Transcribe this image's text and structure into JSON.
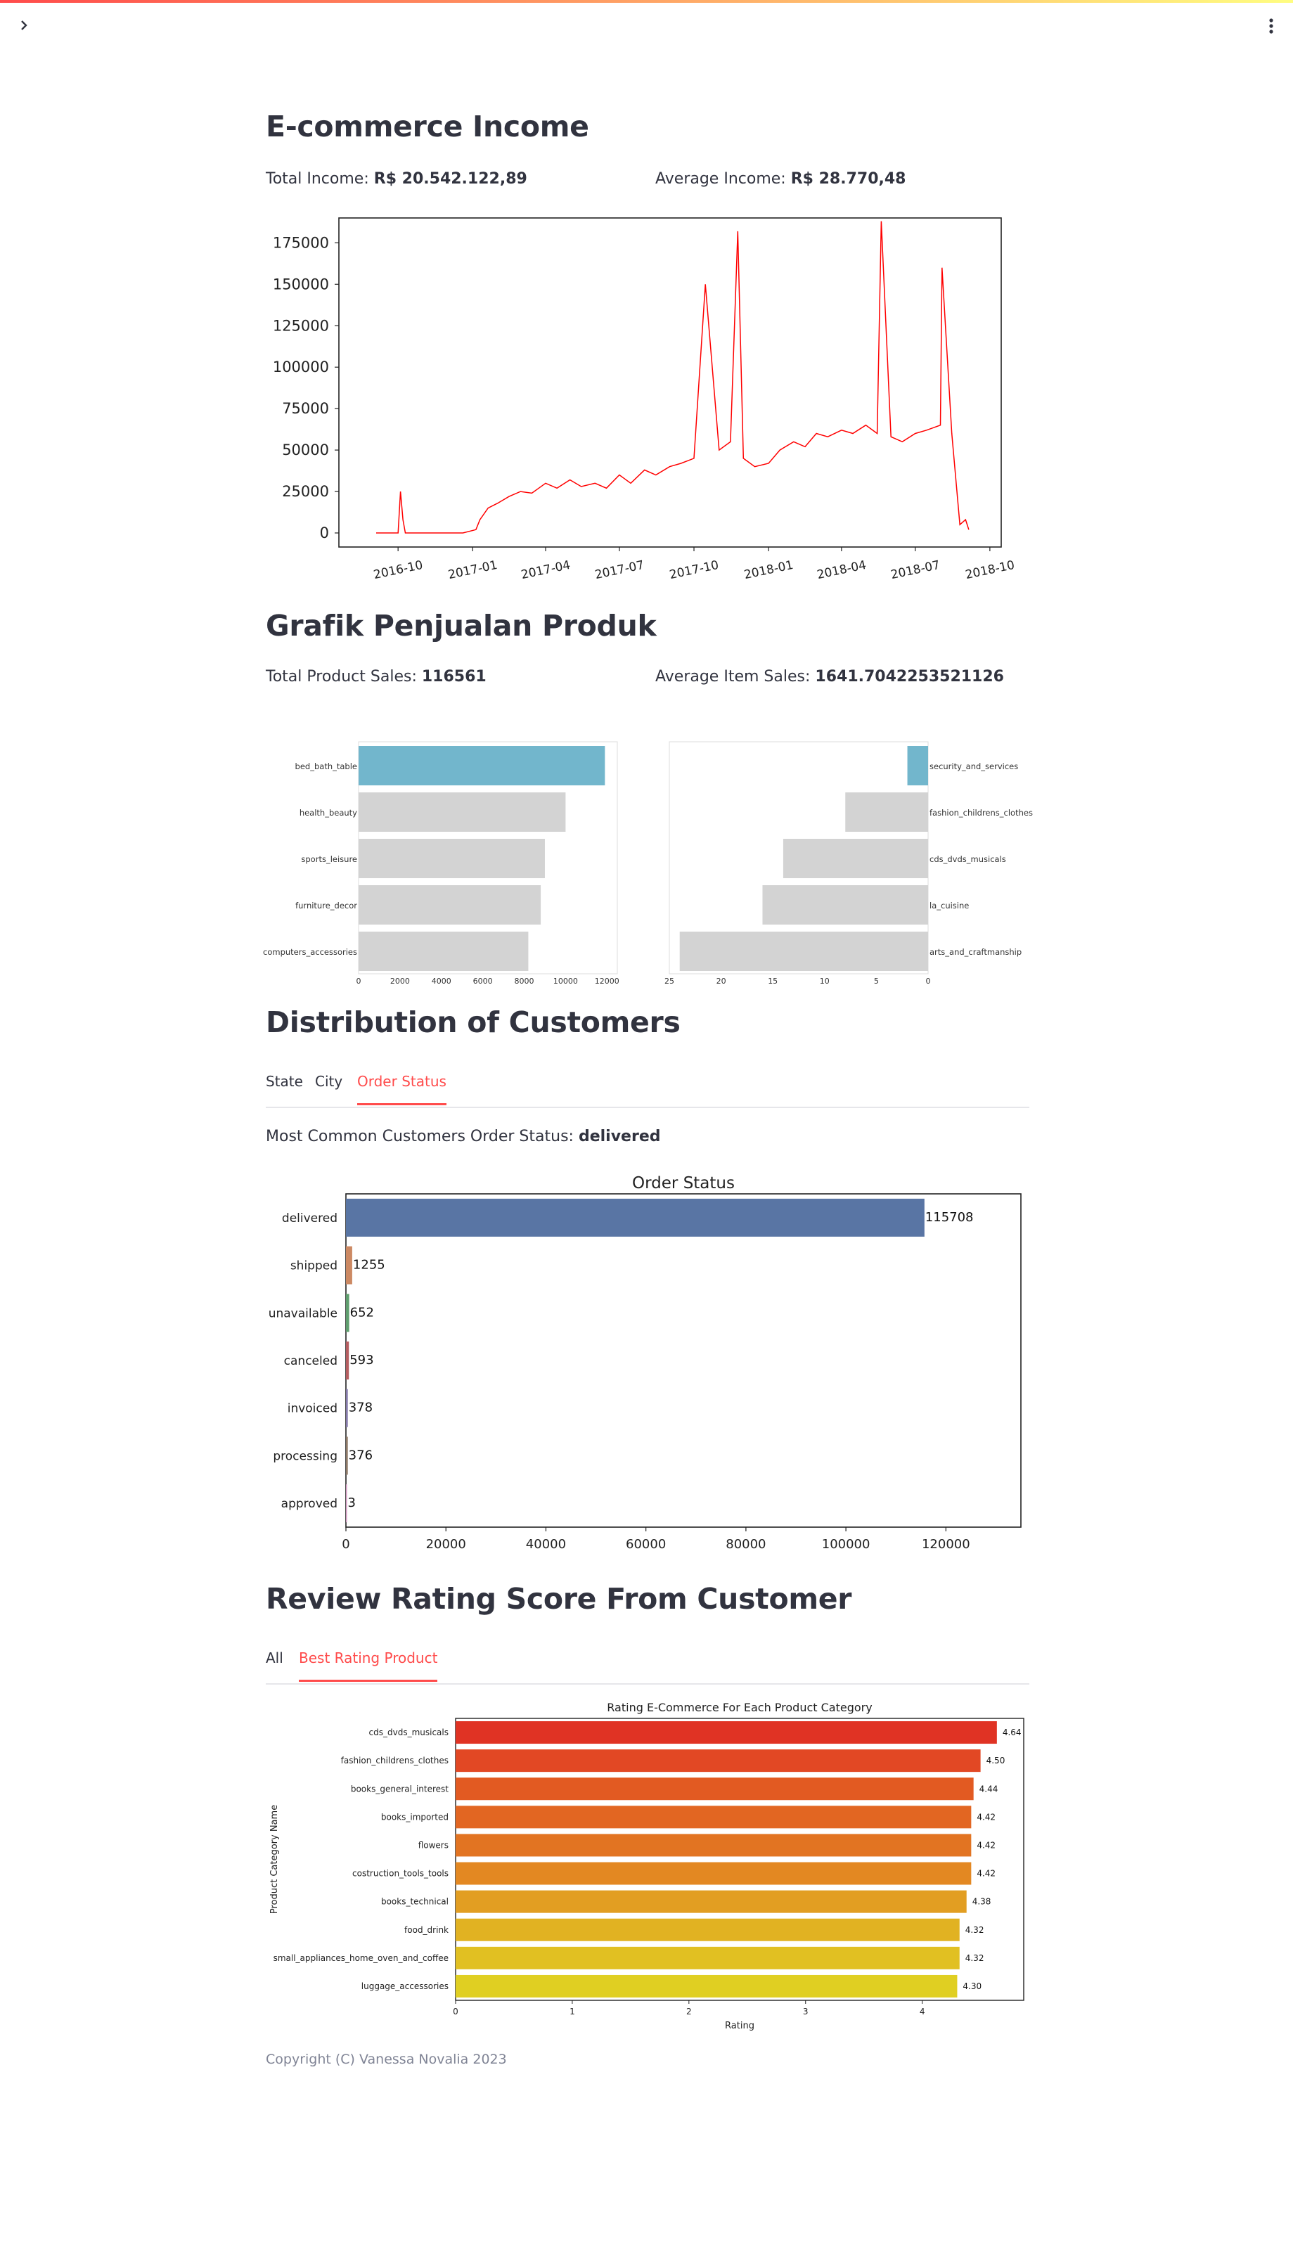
{
  "header": {
    "sidebar_toggle_icon": "chevron-right-icon",
    "menu_icon": "vertical-ellipsis-icon"
  },
  "income": {
    "title": "E-commerce Income",
    "total_label": "Total Income:",
    "total_value": "R$ 20.542.122,89",
    "avg_label": "Average Income:",
    "avg_value": "R$ 28.770,48"
  },
  "sales": {
    "title": "Grafik Penjualan Produk",
    "total_label": "Total Product Sales:",
    "total_value": "116561",
    "avg_label": "Average Item Sales:",
    "avg_value": "1641.7042253521126"
  },
  "customers": {
    "title": "Distribution of Customers",
    "tabs": [
      {
        "label": "State"
      },
      {
        "label": "City"
      },
      {
        "label": "Order Status"
      }
    ],
    "active_tab": "Order Status",
    "common_label": "Most Common Customers Order Status:",
    "common_value": "delivered"
  },
  "reviews": {
    "title": "Review Rating Score From Customer",
    "tabs": [
      {
        "label": "All"
      },
      {
        "label": "Best Rating Product"
      }
    ],
    "active_tab": "Best Rating Product"
  },
  "footer": {
    "copyright": "Copyright (C) Vanessa Novalia 2023"
  },
  "colors": {
    "accent": "#ff4b4b",
    "text": "#31333f",
    "income_line": "#ff0000",
    "highlight_bar": "#72b6cc",
    "muted_bar": "#d3d3d3"
  },
  "chart_data": [
    {
      "type": "line",
      "title": "",
      "xlabel": "",
      "ylabel": "",
      "ylim": [
        0,
        190000
      ],
      "x_tick_labels": [
        "2016-10",
        "2017-01",
        "2017-04",
        "2017-07",
        "2017-10",
        "2018-01",
        "2018-04",
        "2018-07",
        "2018-10"
      ],
      "y_tick_labels": [
        "0",
        "25000",
        "50000",
        "75000",
        "100000",
        "125000",
        "150000",
        "175000"
      ],
      "series": [
        {
          "x": [
            "2016-09-04",
            "2016-10-01",
            "2016-10-04",
            "2016-10-07",
            "2016-10-10",
            "2016-12-20",
            "2017-01-05",
            "2017-01-10",
            "2017-01-20",
            "2017-02-01",
            "2017-02-15",
            "2017-03-01",
            "2017-03-15",
            "2017-04-01",
            "2017-04-15",
            "2017-05-01",
            "2017-05-15",
            "2017-06-01",
            "2017-06-15",
            "2017-07-01",
            "2017-07-15",
            "2017-08-01",
            "2017-08-15",
            "2017-09-01",
            "2017-09-15",
            "2017-10-01",
            "2017-10-15",
            "2017-11-01",
            "2017-11-15",
            "2017-11-24",
            "2017-12-01",
            "2017-12-15",
            "2018-01-01",
            "2018-01-15",
            "2018-02-01",
            "2018-02-15",
            "2018-03-01",
            "2018-03-15",
            "2018-04-01",
            "2018-04-15",
            "2018-05-01",
            "2018-05-15",
            "2018-05-20",
            "2018-06-01",
            "2018-06-15",
            "2018-07-01",
            "2018-07-15",
            "2018-08-01",
            "2018-08-03",
            "2018-08-15",
            "2018-08-25",
            "2018-09-01",
            "2018-09-05"
          ],
          "y": [
            0,
            0,
            25000,
            8000,
            0,
            0,
            2000,
            8000,
            15000,
            18000,
            22000,
            25000,
            24000,
            30000,
            27000,
            32000,
            28000,
            30000,
            27000,
            35000,
            30000,
            38000,
            35000,
            40000,
            42000,
            45000,
            150000,
            50000,
            55000,
            182000,
            45000,
            40000,
            42000,
            50000,
            55000,
            52000,
            60000,
            58000,
            62000,
            60000,
            65000,
            60000,
            188000,
            58000,
            55000,
            60000,
            62000,
            65000,
            160000,
            60000,
            5000,
            8000,
            2000
          ],
          "color": "#ff0000"
        }
      ]
    },
    {
      "type": "bar",
      "title": "",
      "orientation": "horizontal",
      "categories": [
        "bed_bath_table",
        "health_beauty",
        "sports_leisure",
        "furniture_decor",
        "computers_accessories"
      ],
      "values": [
        11900,
        10000,
        9000,
        8800,
        8200
      ],
      "xlim": [
        0,
        12500
      ],
      "x_tick_labels": [
        "0",
        "2000",
        "4000",
        "6000",
        "8000",
        "10000",
        "12000"
      ]
    },
    {
      "type": "bar",
      "title": "",
      "orientation": "horizontal",
      "x_inverted": true,
      "y_axis_side": "right",
      "categories": [
        "security_and_services",
        "fashion_childrens_clothes",
        "cds_dvds_musicals",
        "la_cuisine",
        "arts_and_craftmanship"
      ],
      "values": [
        2,
        8,
        14,
        16,
        24
      ],
      "xlim": [
        0,
        25
      ],
      "x_tick_labels": [
        "25",
        "20",
        "15",
        "10",
        "5",
        "0"
      ]
    },
    {
      "type": "bar",
      "title": "Order Status",
      "orientation": "horizontal",
      "categories": [
        "delivered",
        "shipped",
        "unavailable",
        "canceled",
        "invoiced",
        "processing",
        "approved"
      ],
      "values": [
        115708,
        1255,
        652,
        593,
        378,
        376,
        3
      ],
      "data_labels": [
        "115708",
        "1255",
        "652",
        "593",
        "378",
        "376",
        "3"
      ],
      "colors": [
        "#5975a4",
        "#cc8963",
        "#5f9e6e",
        "#b55d60",
        "#857aab",
        "#8d7866",
        "#d095bf"
      ],
      "xlim": [
        0,
        135000
      ],
      "x_tick_labels": [
        "0",
        "20000",
        "40000",
        "60000",
        "80000",
        "100000",
        "120000"
      ]
    },
    {
      "type": "bar",
      "title": "Rating E-Commerce For Each Product Category",
      "orientation": "horizontal",
      "xlabel": "Rating",
      "ylabel": "Product Category Name",
      "categories": [
        "cds_dvds_musicals",
        "fashion_childrens_clothes",
        "books_general_interest",
        "books_imported",
        "flowers",
        "costruction_tools_tools",
        "books_technical",
        "food_drink",
        "small_appliances_home_oven_and_coffee",
        "luggage_accessories"
      ],
      "values": [
        4.64,
        4.5,
        4.44,
        4.42,
        4.42,
        4.42,
        4.38,
        4.32,
        4.32,
        4.3
      ],
      "data_labels": [
        "4.64",
        "4.50",
        "4.44",
        "4.42",
        "4.42",
        "4.42",
        "4.38",
        "4.32",
        "4.32",
        "4.30"
      ],
      "colors": [
        "#e03324",
        "#e24824",
        "#e25a22",
        "#e26622",
        "#e27422",
        "#e38822",
        "#e29e22",
        "#e1b222",
        "#e1c022",
        "#e0cf22"
      ],
      "xlim": [
        0,
        4.87
      ],
      "x_tick_labels": [
        "0",
        "1",
        "2",
        "3",
        "4"
      ]
    }
  ]
}
